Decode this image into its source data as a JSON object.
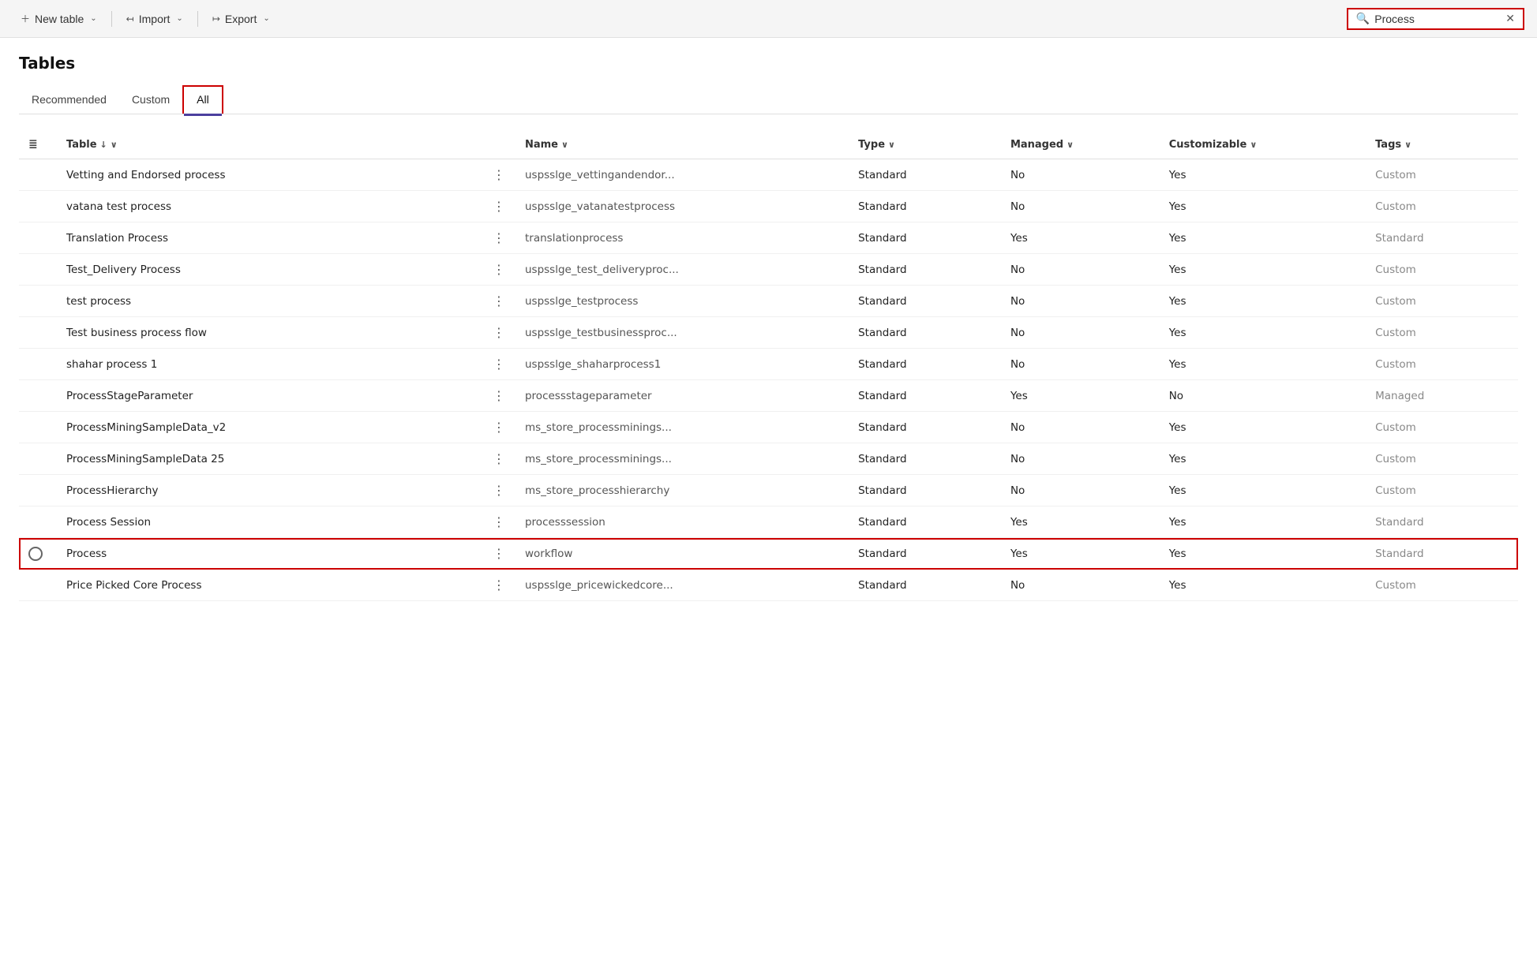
{
  "toolbar": {
    "new_table_label": "New table",
    "import_label": "Import",
    "export_label": "Export"
  },
  "search": {
    "value": "Process",
    "placeholder": "Search"
  },
  "page": {
    "title": "Tables"
  },
  "tabs": [
    {
      "id": "recommended",
      "label": "Recommended",
      "active": false
    },
    {
      "id": "custom",
      "label": "Custom",
      "active": false
    },
    {
      "id": "all",
      "label": "All",
      "active": true
    }
  ],
  "table": {
    "columns": [
      {
        "id": "table",
        "label": "Table",
        "sort": "↓",
        "chevron": "∨"
      },
      {
        "id": "name",
        "label": "Name",
        "chevron": "∨"
      },
      {
        "id": "type",
        "label": "Type",
        "chevron": "∨"
      },
      {
        "id": "managed",
        "label": "Managed",
        "chevron": "∨"
      },
      {
        "id": "customizable",
        "label": "Customizable",
        "chevron": "∨"
      },
      {
        "id": "tags",
        "label": "Tags",
        "chevron": "∨"
      }
    ],
    "rows": [
      {
        "id": 1,
        "table": "Vetting and Endorsed process",
        "name": "uspsslge_vettingandendor...",
        "type": "Standard",
        "managed": "No",
        "customizable": "Yes",
        "tags": "Custom",
        "highlighted": false,
        "has_radio": false
      },
      {
        "id": 2,
        "table": "vatana test process",
        "name": "uspsslge_vatanatestprocess",
        "type": "Standard",
        "managed": "No",
        "customizable": "Yes",
        "tags": "Custom",
        "highlighted": false,
        "has_radio": false
      },
      {
        "id": 3,
        "table": "Translation Process",
        "name": "translationprocess",
        "type": "Standard",
        "managed": "Yes",
        "customizable": "Yes",
        "tags": "Standard",
        "highlighted": false,
        "has_radio": false
      },
      {
        "id": 4,
        "table": "Test_Delivery Process",
        "name": "uspsslge_test_deliveryproc...",
        "type": "Standard",
        "managed": "No",
        "customizable": "Yes",
        "tags": "Custom",
        "highlighted": false,
        "has_radio": false
      },
      {
        "id": 5,
        "table": "test process",
        "name": "uspsslge_testprocess",
        "type": "Standard",
        "managed": "No",
        "customizable": "Yes",
        "tags": "Custom",
        "highlighted": false,
        "has_radio": false
      },
      {
        "id": 6,
        "table": "Test business process flow",
        "name": "uspsslge_testbusinessproc...",
        "type": "Standard",
        "managed": "No",
        "customizable": "Yes",
        "tags": "Custom",
        "highlighted": false,
        "has_radio": false
      },
      {
        "id": 7,
        "table": "shahar process 1",
        "name": "uspsslge_shaharprocess1",
        "type": "Standard",
        "managed": "No",
        "customizable": "Yes",
        "tags": "Custom",
        "highlighted": false,
        "has_radio": false
      },
      {
        "id": 8,
        "table": "ProcessStageParameter",
        "name": "processstageparameter",
        "type": "Standard",
        "managed": "Yes",
        "customizable": "No",
        "tags": "Managed",
        "highlighted": false,
        "has_radio": false
      },
      {
        "id": 9,
        "table": "ProcessMiningSampleData_v2",
        "name": "ms_store_processminings...",
        "type": "Standard",
        "managed": "No",
        "customizable": "Yes",
        "tags": "Custom",
        "highlighted": false,
        "has_radio": false
      },
      {
        "id": 10,
        "table": "ProcessMiningSampleData 25",
        "name": "ms_store_processminings...",
        "type": "Standard",
        "managed": "No",
        "customizable": "Yes",
        "tags": "Custom",
        "highlighted": false,
        "has_radio": false
      },
      {
        "id": 11,
        "table": "ProcessHierarchy",
        "name": "ms_store_processhierarchy",
        "type": "Standard",
        "managed": "No",
        "customizable": "Yes",
        "tags": "Custom",
        "highlighted": false,
        "has_radio": false
      },
      {
        "id": 12,
        "table": "Process Session",
        "name": "processsession",
        "type": "Standard",
        "managed": "Yes",
        "customizable": "Yes",
        "tags": "Standard",
        "highlighted": false,
        "has_radio": false
      },
      {
        "id": 13,
        "table": "Process",
        "name": "workflow",
        "type": "Standard",
        "managed": "Yes",
        "customizable": "Yes",
        "tags": "Standard",
        "highlighted": true,
        "has_radio": true
      },
      {
        "id": 14,
        "table": "Price Picked Core Process",
        "name": "uspsslge_pricewickedcore...",
        "type": "Standard",
        "managed": "No",
        "customizable": "Yes",
        "tags": "Custom",
        "highlighted": false,
        "has_radio": false
      }
    ]
  }
}
